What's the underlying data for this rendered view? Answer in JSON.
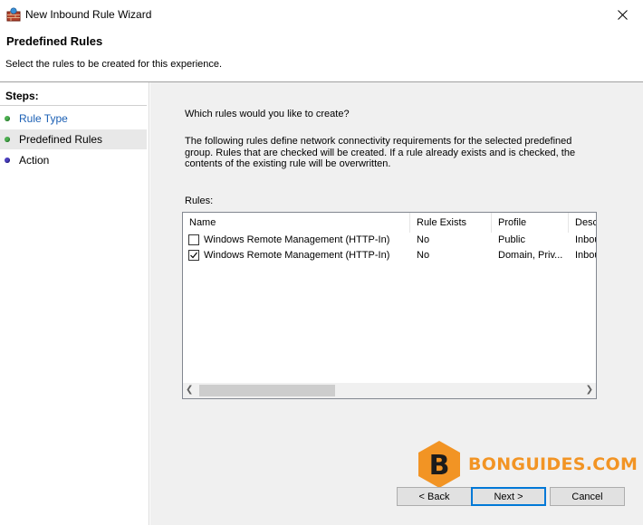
{
  "window": {
    "title": "New Inbound Rule Wizard"
  },
  "header": {
    "title": "Predefined Rules",
    "subtitle": "Select the rules to be created for this experience."
  },
  "steps": {
    "heading": "Steps:",
    "items": [
      {
        "label": "Rule Type",
        "state": "done",
        "color": "#1a5fb4",
        "dot": "#4caf50"
      },
      {
        "label": "Predefined Rules",
        "state": "current",
        "color": "#000000",
        "dot": "#4caf50"
      },
      {
        "label": "Action",
        "state": "pending",
        "color": "#000000",
        "dot": "#4b3fbf"
      }
    ]
  },
  "main": {
    "question": "Which rules would you like to create?",
    "description": "The following rules define network connectivity requirements for the selected predefined group. Rules that are checked will be created. If a rule already exists and is checked, the contents of the existing rule will be overwritten.",
    "rules_label": "Rules:",
    "columns": [
      "Name",
      "Rule Exists",
      "Profile",
      "Desc"
    ],
    "rows": [
      {
        "checked": false,
        "name": "Windows Remote Management (HTTP-In)",
        "exists": "No",
        "profile": "Public",
        "desc": "Inbou"
      },
      {
        "checked": true,
        "name": "Windows Remote Management (HTTP-In)",
        "exists": "No",
        "profile": "Domain, Priv...",
        "desc": "Inbou"
      }
    ]
  },
  "watermark": {
    "letter": "B",
    "text": "BONGUIDES.COM",
    "color": "#f29424"
  },
  "buttons": {
    "back": "< Back",
    "next": "Next >",
    "cancel": "Cancel"
  }
}
